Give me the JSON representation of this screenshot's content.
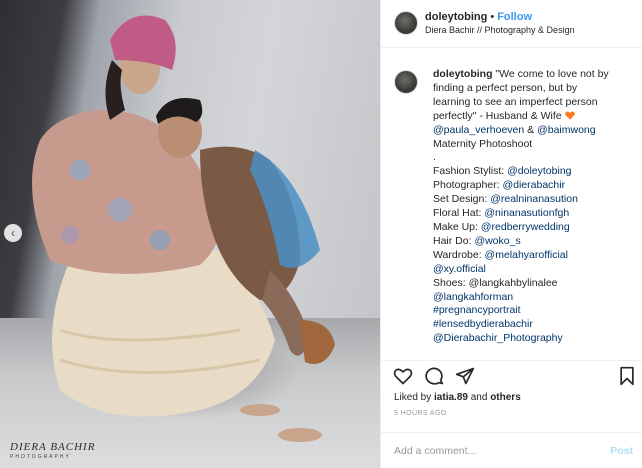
{
  "post": {
    "username": "doleytobing",
    "follow_label": "Follow",
    "separator": "•",
    "location": "Diera Bachir // Photography & Design"
  },
  "photo": {
    "alt": "Maternity photoshoot of a couple",
    "watermark_name": "DIERA BACHIR",
    "watermark_sub": "PHOTOGRAPHY",
    "slide_icon": "chevron-left-icon"
  },
  "caption": {
    "username": "doleytobing",
    "lines": [
      "\"We come to love not by",
      "finding a perfect person, but by",
      "learning to see an imperfect person",
      "perfectly\" - Husband & Wife"
    ],
    "mention1": "@paula_verhoeven",
    "amp": " & ",
    "mention2": "@baimwong",
    "maternity": "Maternity Photoshoot",
    "dot": ".",
    "credits": [
      {
        "label": "Fashion Stylist: ",
        "handle": "@doleytobing"
      },
      {
        "label": "Photographer: ",
        "handle": "@dierabachir"
      },
      {
        "label": "Set Design: ",
        "handle": "@realninanasution"
      },
      {
        "label": "Floral Hat: ",
        "handle": "@ninanasutionfgh"
      },
      {
        "label": "Make Up: ",
        "handle": "@redberrywedding"
      },
      {
        "label": "Hair Do: ",
        "handle": "@woko_s"
      },
      {
        "label": "Wardrobe: ",
        "handle": "@melahyarofficial"
      }
    ],
    "extra_lines": [
      "@xy.official",
      "Shoes: @langkahbylinalee",
      "@langkahforman",
      "#pregnancyportrait",
      "#lensedbydierabachir",
      "@Dierabachir_Photography"
    ]
  },
  "actions": {
    "icons": [
      "heart-icon",
      "comment-icon",
      "share-icon",
      "bookmark-icon"
    ]
  },
  "likes": {
    "prefix": "Liked by ",
    "user": "iatia.89",
    "middle": " and ",
    "others": "others"
  },
  "timestamp": "9 HOURS AGO",
  "comment": {
    "placeholder": "Add a comment...",
    "post_label": "Post"
  },
  "colors": {
    "link": "#003569",
    "follow": "#3897f0",
    "post_disabled": "#b2dffc",
    "heart_emoji": "#ff7a1a"
  }
}
